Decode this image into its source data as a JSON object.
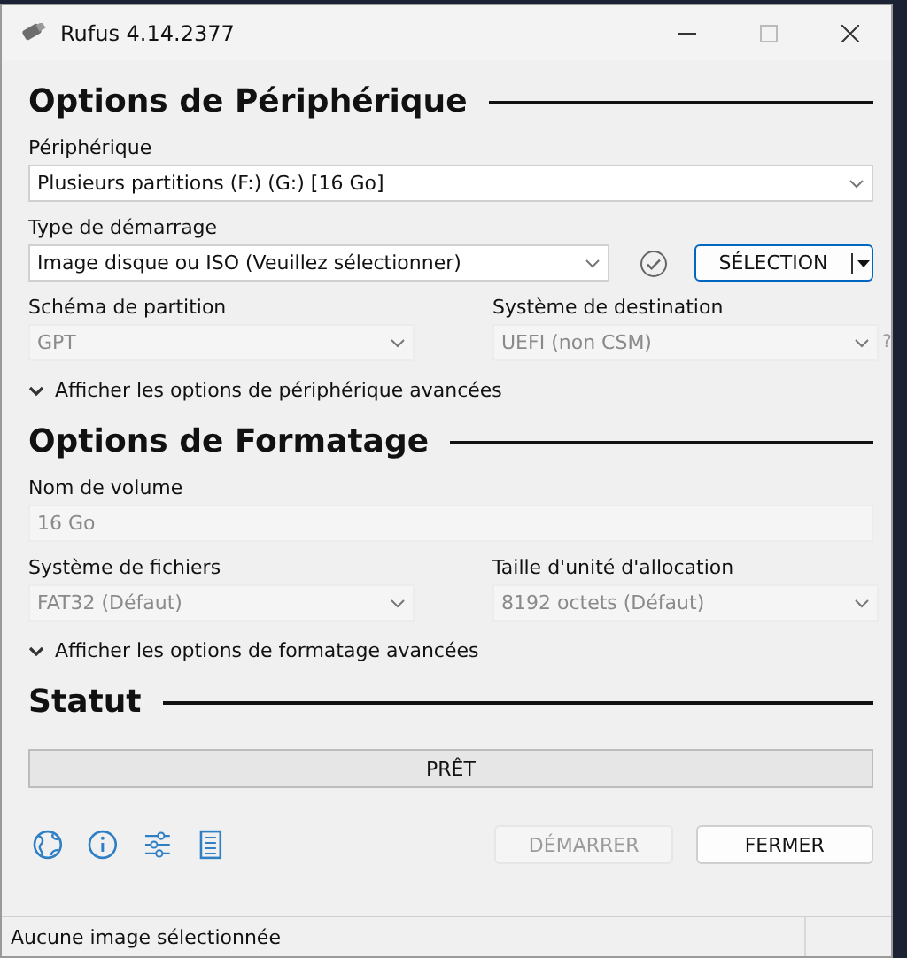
{
  "window": {
    "title": "Rufus 4.14.2377"
  },
  "device_options": {
    "heading": "Options de Périphérique",
    "device": {
      "label": "Périphérique",
      "value": "Plusieurs partitions (F:) (G:) [16 Go]",
      "disabled": false
    },
    "boot_selection": {
      "label": "Type de démarrage",
      "value": "Image disque ou ISO (Veuillez sélectionner)",
      "disabled": false
    },
    "select_button": {
      "label": "SÉLECTION"
    },
    "partition_scheme": {
      "label": "Schéma de partition",
      "value": "GPT",
      "disabled": true
    },
    "target_system": {
      "label": "Système de destination",
      "value": "UEFI (non CSM)",
      "disabled": true,
      "help": "?"
    },
    "advanced_toggle": {
      "label": "Afficher les options de périphérique avancées",
      "expanded": false
    }
  },
  "format_options": {
    "heading": "Options de Formatage",
    "volume_label": {
      "label": "Nom de volume",
      "value": "16 Go",
      "disabled": true
    },
    "file_system": {
      "label": "Système de fichiers",
      "value": "FAT32 (Défaut)",
      "disabled": true
    },
    "cluster_size": {
      "label": "Taille d'unité d'allocation",
      "value": "8192 octets (Défaut)",
      "disabled": true
    },
    "advanced_toggle": {
      "label": "Afficher les options de formatage avancées",
      "expanded": false
    }
  },
  "status": {
    "heading": "Statut",
    "progress": {
      "text": "PRÊT"
    }
  },
  "buttons": [
    {
      "label": "DÉMARRER",
      "disabled": true
    },
    {
      "label": "FERMER",
      "disabled": false
    }
  ],
  "status_bar": {
    "text": "Aucune image sélectionnée"
  }
}
